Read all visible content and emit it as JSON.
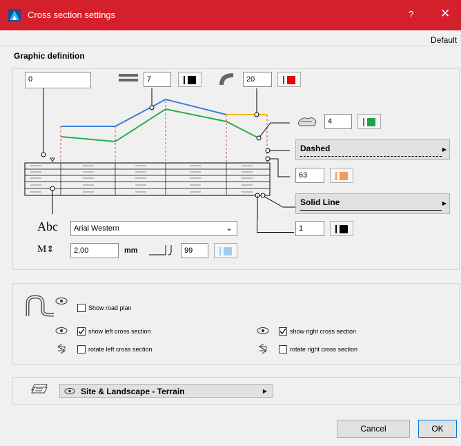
{
  "window": {
    "title": "Cross section settings",
    "help": "?",
    "close": "✕",
    "defaults": "Default"
  },
  "graphic_definition": {
    "label": "Graphic definition",
    "offset_value": "0",
    "line_weight_value": "7",
    "curve_value": "20",
    "terrain_value": "4",
    "dashed_label": "Dashed",
    "pen_dashed_value": "63",
    "solid_label": "Solid Line",
    "pen_solid_value": "1",
    "font_name": "Arial Western",
    "text_size_value": "2,00",
    "text_size_unit": "mm",
    "text_pen_value": "99",
    "abc_label": "Abc",
    "size_label": "M",
    "colors": {
      "line_black": "#000000",
      "curve_red": "#e8000c",
      "terrain_green": "#1aa64a",
      "dashed_orange": "#f39a5a",
      "text_blue": "#9ecbf0",
      "profile_blue": "#3b7fd4",
      "profile_green": "#22b14c",
      "profile_yellow": "#f6b500",
      "dash_red": "#e23b3b"
    }
  },
  "visibility": {
    "road_plan_label": "Show road plan",
    "left_cross_label": "show left cross section",
    "right_cross_label": "show right cross section",
    "rotate_left_label": "rotate left cross section",
    "rotate_right_label": "rotate right cross section"
  },
  "layer": {
    "value": "Site & Landscape - Terrain"
  },
  "footer": {
    "cancel": "Cancel",
    "ok": "OK"
  }
}
